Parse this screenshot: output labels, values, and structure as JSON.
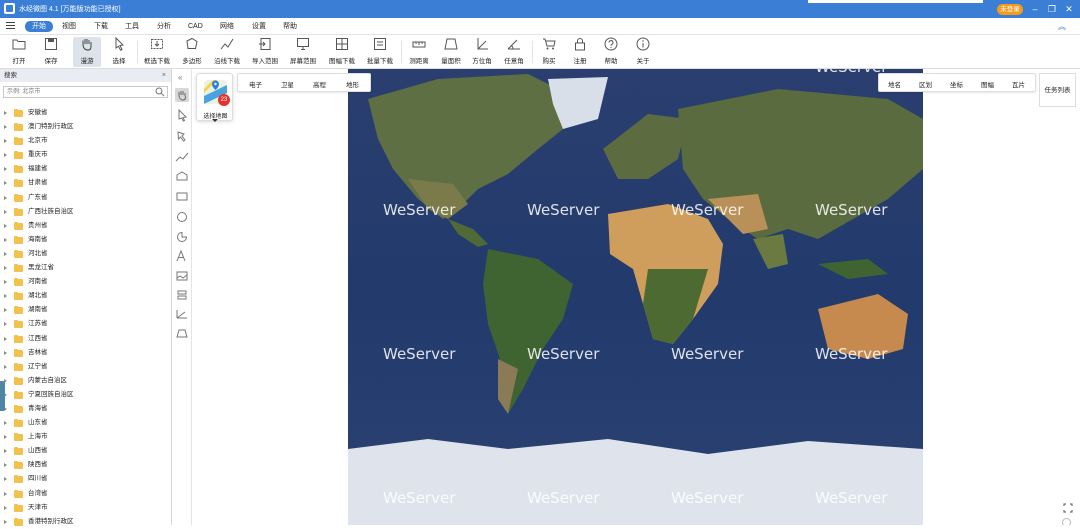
{
  "window": {
    "title": "水经微图 4.1 [万能版功能已授权]",
    "login_label": "未登录",
    "controls": [
      "–",
      "❐",
      "✕"
    ]
  },
  "menu": {
    "items": [
      "开始",
      "视图",
      "下载",
      "工具",
      "分析",
      "CAD",
      "网络",
      "设置",
      "帮助"
    ],
    "active_index": 0
  },
  "toolbar": {
    "buttons": [
      {
        "label": "打开",
        "icon": "folder-open-icon"
      },
      {
        "label": "保存",
        "icon": "save-icon"
      },
      {
        "label": "漫游",
        "icon": "hand-icon",
        "active": true
      },
      {
        "label": "选择",
        "icon": "cursor-icon"
      },
      {
        "label": "框选下载",
        "icon": "box-select-download-icon"
      },
      {
        "label": "多边形",
        "icon": "polygon-icon"
      },
      {
        "label": "沿线下载",
        "icon": "line-download-icon"
      },
      {
        "label": "导入范围",
        "icon": "import-extent-icon"
      },
      {
        "label": "屏幕范围",
        "icon": "screen-extent-icon"
      },
      {
        "label": "图幅下载",
        "icon": "sheet-download-icon"
      },
      {
        "label": "批量下载",
        "icon": "batch-download-icon"
      },
      {
        "label": "测距离",
        "icon": "measure-distance-icon"
      },
      {
        "label": "量面积",
        "icon": "measure-area-icon"
      },
      {
        "label": "方位角",
        "icon": "azimuth-icon"
      },
      {
        "label": "任意角",
        "icon": "any-angle-icon"
      },
      {
        "label": "购买",
        "icon": "cart-icon"
      },
      {
        "label": "注册",
        "icon": "lock-icon"
      },
      {
        "label": "帮助",
        "icon": "help-icon"
      },
      {
        "label": "关于",
        "icon": "info-icon"
      }
    ]
  },
  "search": {
    "title": "搜索",
    "close": "×",
    "placeholder": "示例: 北京市",
    "regions": [
      "安徽省",
      "澳门特别行政区",
      "北京市",
      "重庆市",
      "福建省",
      "甘肃省",
      "广东省",
      "广西壮族自治区",
      "贵州省",
      "海南省",
      "河北省",
      "黑龙江省",
      "河南省",
      "湖北省",
      "湖南省",
      "江苏省",
      "江西省",
      "吉林省",
      "辽宁省",
      "内蒙古自治区",
      "宁夏回族自治区",
      "青海省",
      "山东省",
      "上海市",
      "山西省",
      "陕西省",
      "四川省",
      "台湾省",
      "天津市",
      "香港特别行政区"
    ]
  },
  "vtoolbar": {
    "collapse": "«"
  },
  "map": {
    "layer_picker_label": "选择地图",
    "badge_count": "23",
    "type_tabs": [
      "电子",
      "卫星",
      "高程",
      "地形"
    ],
    "overlay_tabs": [
      "地名",
      "区划",
      "坐标",
      "图幅",
      "瓦片"
    ],
    "task_list_label": "任务列表",
    "watermark": "WeServer",
    "colors": {
      "ocean": "#243a6b",
      "land": "#5b6e3a",
      "desert": "#c79a5b",
      "ice": "#dfe4ec"
    }
  }
}
